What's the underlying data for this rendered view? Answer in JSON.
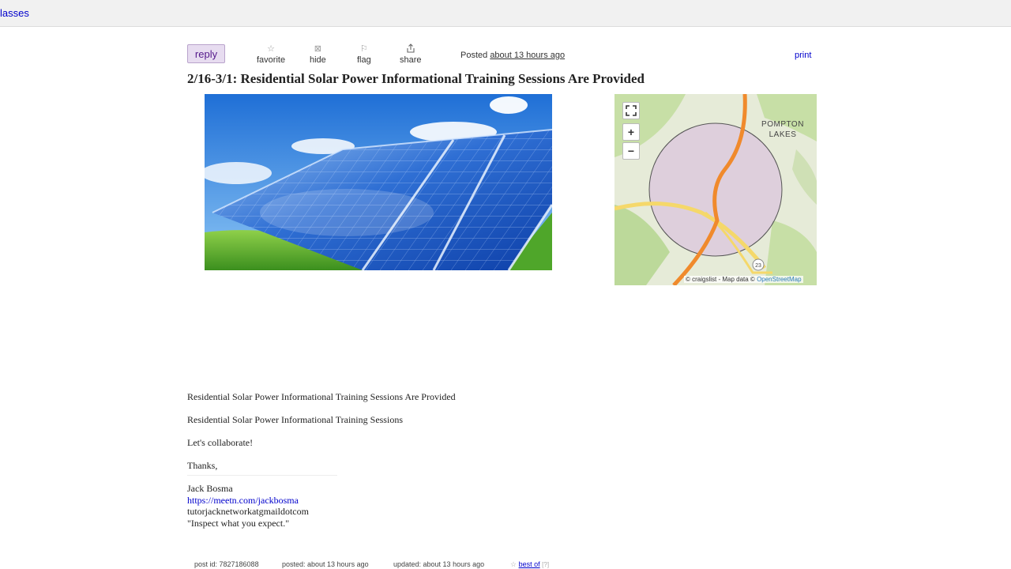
{
  "breadcrumb": {
    "text": "lasses"
  },
  "toolbar": {
    "reply_label": "reply",
    "favorite_label": "favorite",
    "hide_label": "hide",
    "flag_label": "flag",
    "share_label": "share",
    "posted_prefix": "Posted",
    "posted_when": "about 13 hours ago",
    "print_label": "print"
  },
  "post": {
    "title": "2/16-3/1: Residential Solar Power Informational Training Sessions Are Provided",
    "body": {
      "line1": "Residential Solar Power Informational Training Sessions Are Provided",
      "line2": "Residential Solar Power Informational Training Sessions",
      "line3": "Let's collaborate!",
      "line4": "Thanks,",
      "signature_name": "Jack Bosma",
      "signature_link": "https://meetn.com/jackbosma",
      "signature_email": "tutorjacknetworkatgmaildotcom",
      "signature_quote": "\"Inspect what you expect.\""
    }
  },
  "map": {
    "place_label": "POMPTON LAKES",
    "route_shield": "23",
    "zoom_in": "+",
    "zoom_out": "−",
    "attribution_prefix": "© craigslist - Map data ©",
    "attribution_link": "OpenStreetMap"
  },
  "footer": {
    "post_id": "post id: 7827186088",
    "posted": "posted: about 13 hours ago",
    "updated": "updated: about 13 hours ago",
    "best_of": "best of"
  },
  "colors": {
    "link": "#0000cc",
    "reply_bg": "#e7dcf0",
    "highway": "#f08a2c"
  },
  "icons": {
    "favorite": "star-icon",
    "hide": "hide-icon",
    "flag": "flag-icon",
    "share": "share-icon",
    "fullscreen": "fullscreen-icon"
  }
}
